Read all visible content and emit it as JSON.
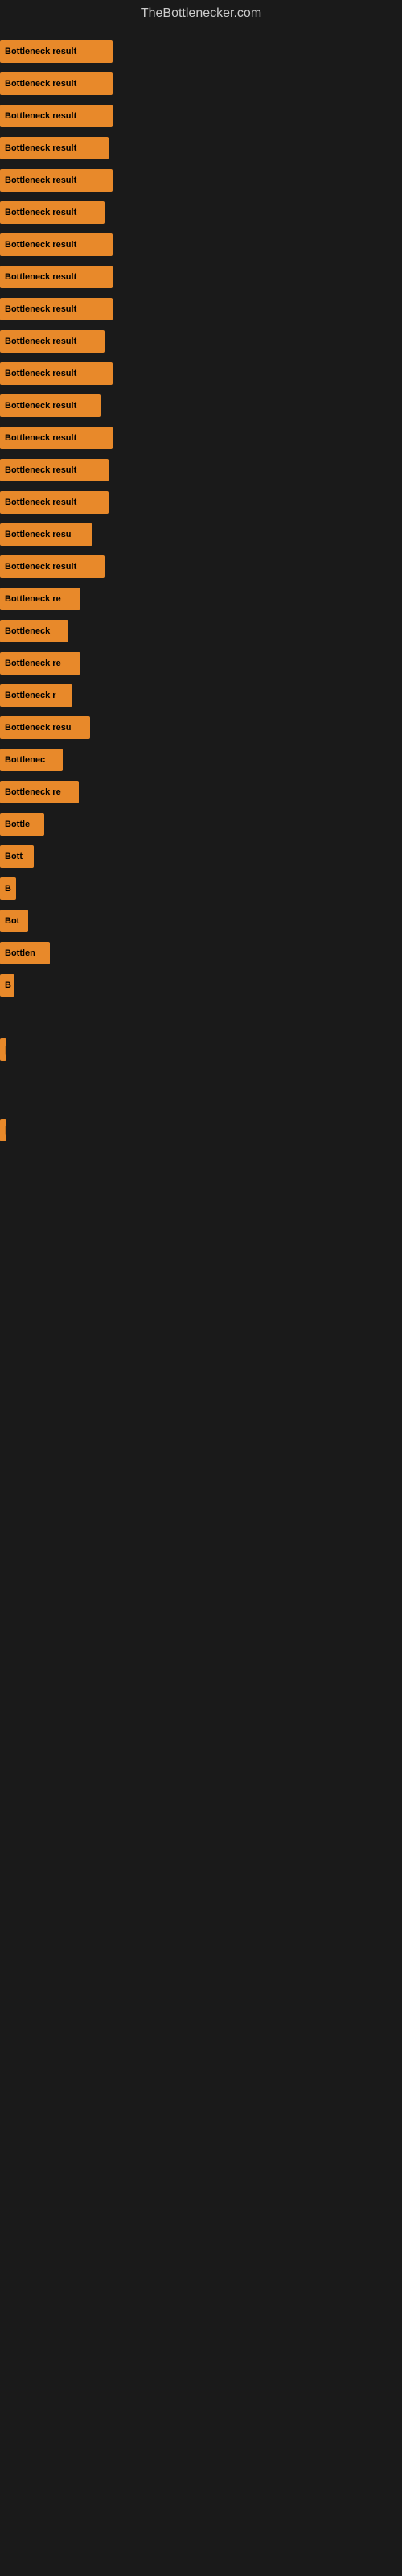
{
  "site": {
    "title": "TheBottlenecker.com"
  },
  "bars": [
    {
      "label": "Bottleneck result",
      "width": 140
    },
    {
      "label": "Bottleneck result",
      "width": 140
    },
    {
      "label": "Bottleneck result",
      "width": 140
    },
    {
      "label": "Bottleneck result",
      "width": 135
    },
    {
      "label": "Bottleneck result",
      "width": 140
    },
    {
      "label": "Bottleneck result",
      "width": 130
    },
    {
      "label": "Bottleneck result",
      "width": 140
    },
    {
      "label": "Bottleneck result",
      "width": 140
    },
    {
      "label": "Bottleneck result",
      "width": 140
    },
    {
      "label": "Bottleneck result",
      "width": 130
    },
    {
      "label": "Bottleneck result",
      "width": 140
    },
    {
      "label": "Bottleneck result",
      "width": 125
    },
    {
      "label": "Bottleneck result",
      "width": 140
    },
    {
      "label": "Bottleneck result",
      "width": 135
    },
    {
      "label": "Bottleneck result",
      "width": 135
    },
    {
      "label": "Bottleneck resu",
      "width": 115
    },
    {
      "label": "Bottleneck result",
      "width": 130
    },
    {
      "label": "Bottleneck re",
      "width": 100
    },
    {
      "label": "Bottleneck",
      "width": 85
    },
    {
      "label": "Bottleneck re",
      "width": 100
    },
    {
      "label": "Bottleneck r",
      "width": 90
    },
    {
      "label": "Bottleneck resu",
      "width": 112
    },
    {
      "label": "Bottlenec",
      "width": 78
    },
    {
      "label": "Bottleneck re",
      "width": 98
    },
    {
      "label": "Bottle",
      "width": 55
    },
    {
      "label": "Bott",
      "width": 42
    },
    {
      "label": "B",
      "width": 20
    },
    {
      "label": "Bot",
      "width": 35
    },
    {
      "label": "Bottlen",
      "width": 62
    },
    {
      "label": "B",
      "width": 18
    },
    {
      "label": "",
      "width": 0
    },
    {
      "label": "",
      "width": 0
    },
    {
      "label": "|",
      "width": 8
    },
    {
      "label": "",
      "width": 0
    },
    {
      "label": "",
      "width": 0
    },
    {
      "label": "",
      "width": 0
    },
    {
      "label": "|",
      "width": 8
    }
  ]
}
